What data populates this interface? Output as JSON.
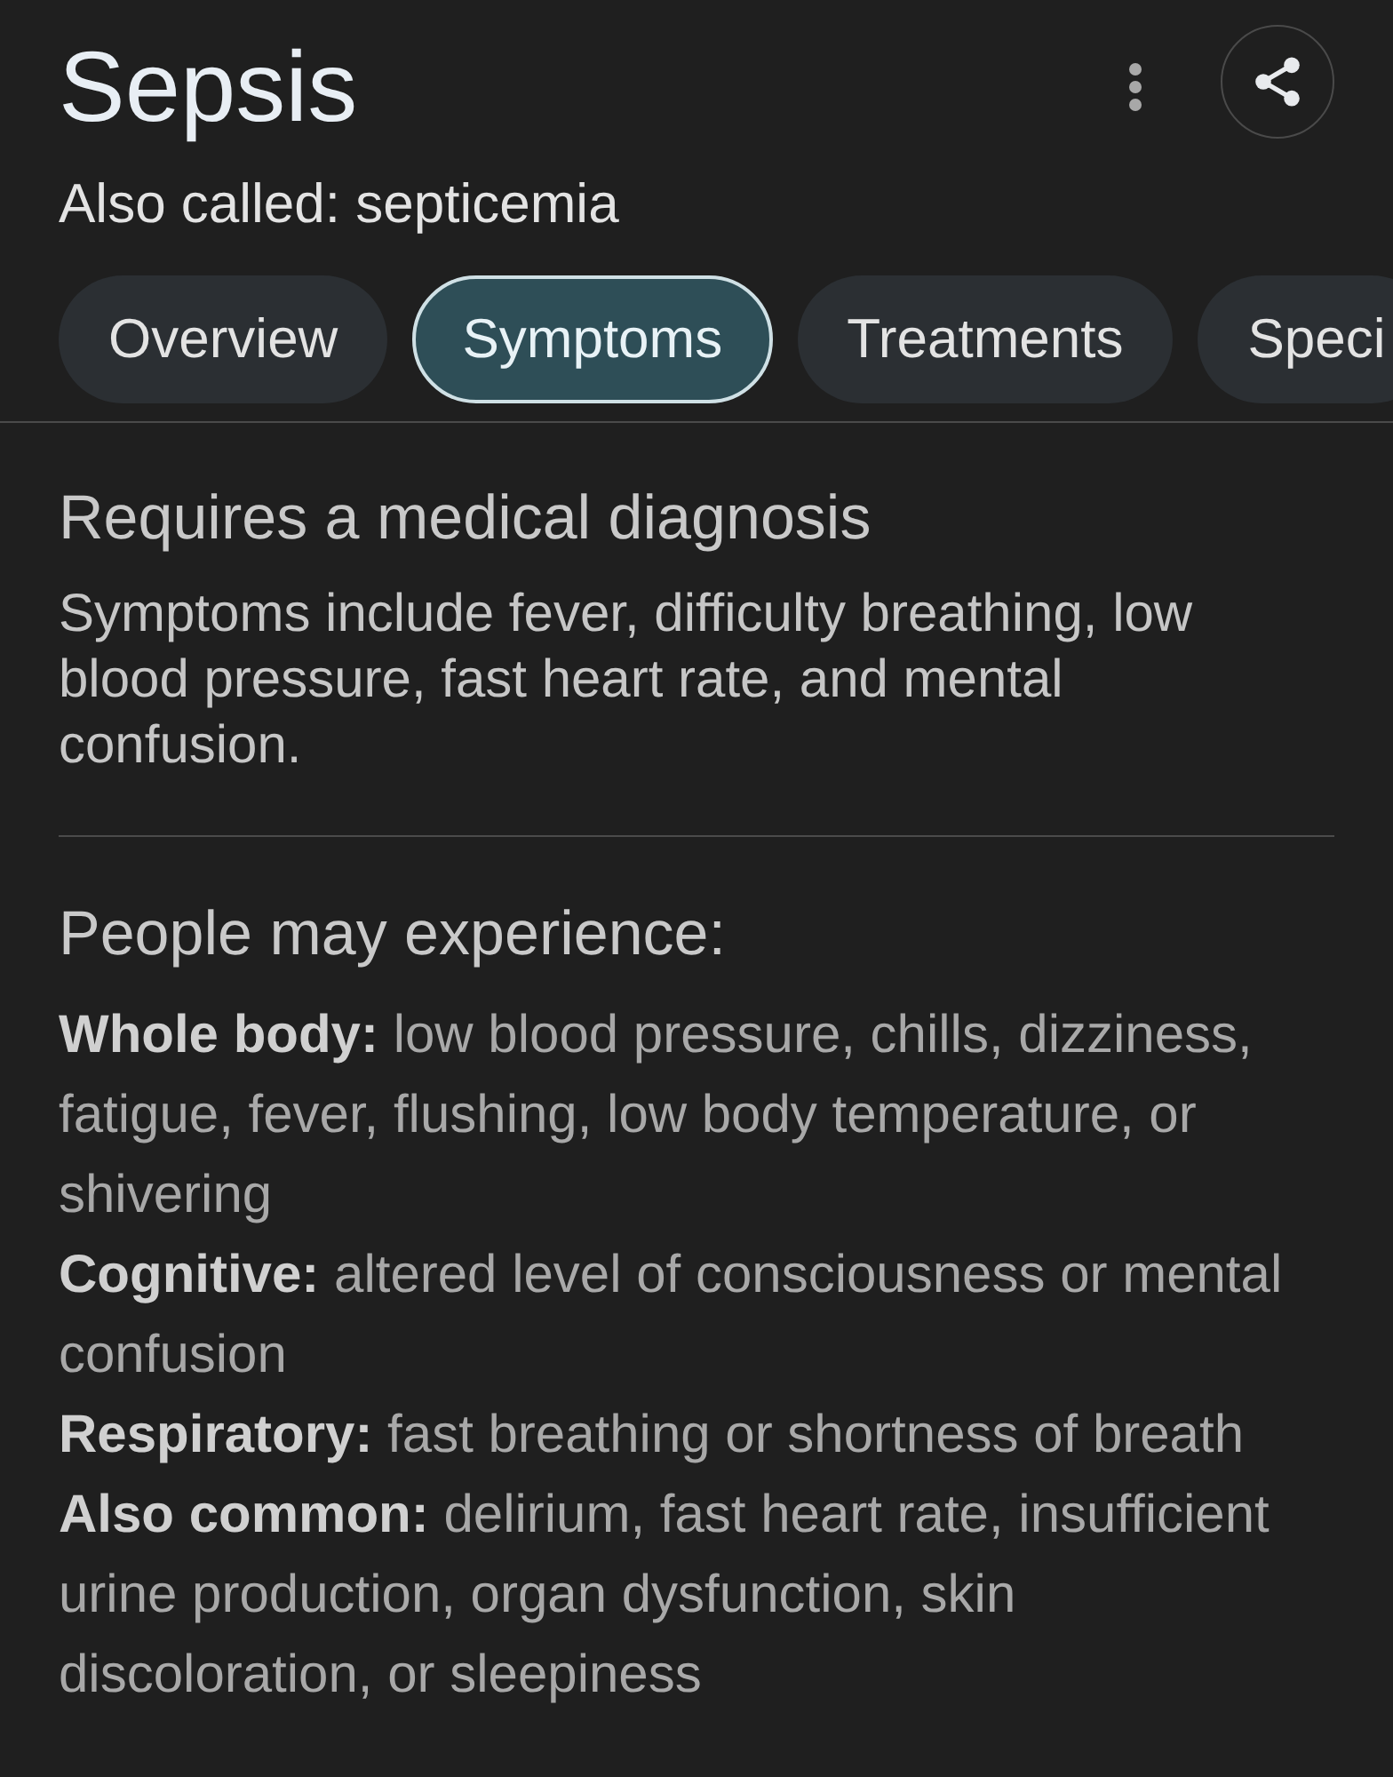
{
  "header": {
    "title": "Sepsis",
    "subtitle": "Also called: septicemia"
  },
  "tabs": [
    {
      "label": "Overview",
      "selected": false
    },
    {
      "label": "Symptoms",
      "selected": true
    },
    {
      "label": "Treatments",
      "selected": false
    },
    {
      "label": "Speci",
      "selected": false
    }
  ],
  "diagnosis": {
    "heading": "Requires a medical diagnosis",
    "text": "Symptoms include fever, difficulty breathing, low blood pressure, fast heart rate, and mental confusion."
  },
  "symptoms": {
    "heading": "People may experience:",
    "items": [
      "**Whole body:** low blood pressure, chills, dizziness, fatigue, fever, flushing, low body temperature, or shivering",
      "**Cognitive:** altered level of consciousness or mental confusion",
      "**Respiratory:** fast breathing or shortness of breath",
      "**Also common:** delirium, fast heart rate, insufficient urine production, organ dysfunction, skin discoloration, or sleepiness"
    ]
  }
}
